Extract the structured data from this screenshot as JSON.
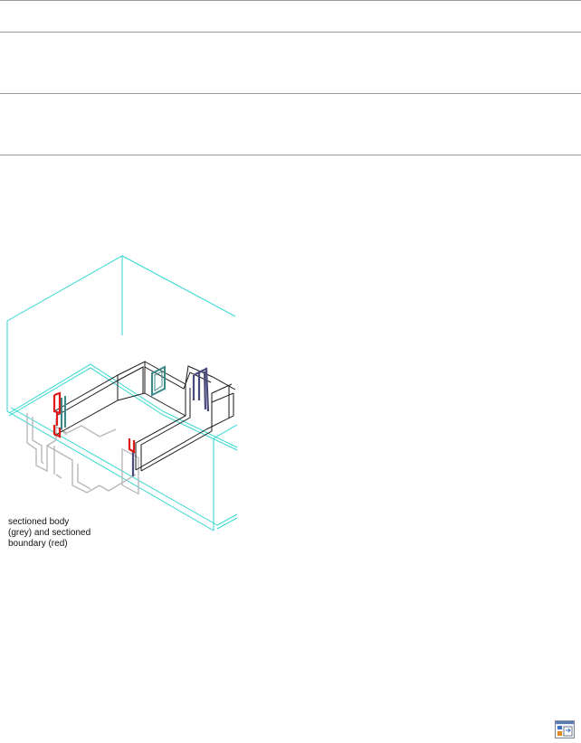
{
  "page": {
    "background": "#ffffff",
    "rule_color": "#9a9a9a"
  },
  "figure": {
    "caption": {
      "line1": "sectioned body",
      "line2": "(grey) and sectioned",
      "line3": "boundary (red)"
    },
    "colors": {
      "section_box": "#2fd6d0",
      "wall_outline": "#1a1a1a",
      "sectioned_body": "#b8b8b8",
      "sectioned_boundary": "#e01818",
      "window_frame": "#3a8a8a",
      "door_frame": "#4a4a7a"
    }
  },
  "icon": {
    "name": "dialog-toggle-icon"
  }
}
